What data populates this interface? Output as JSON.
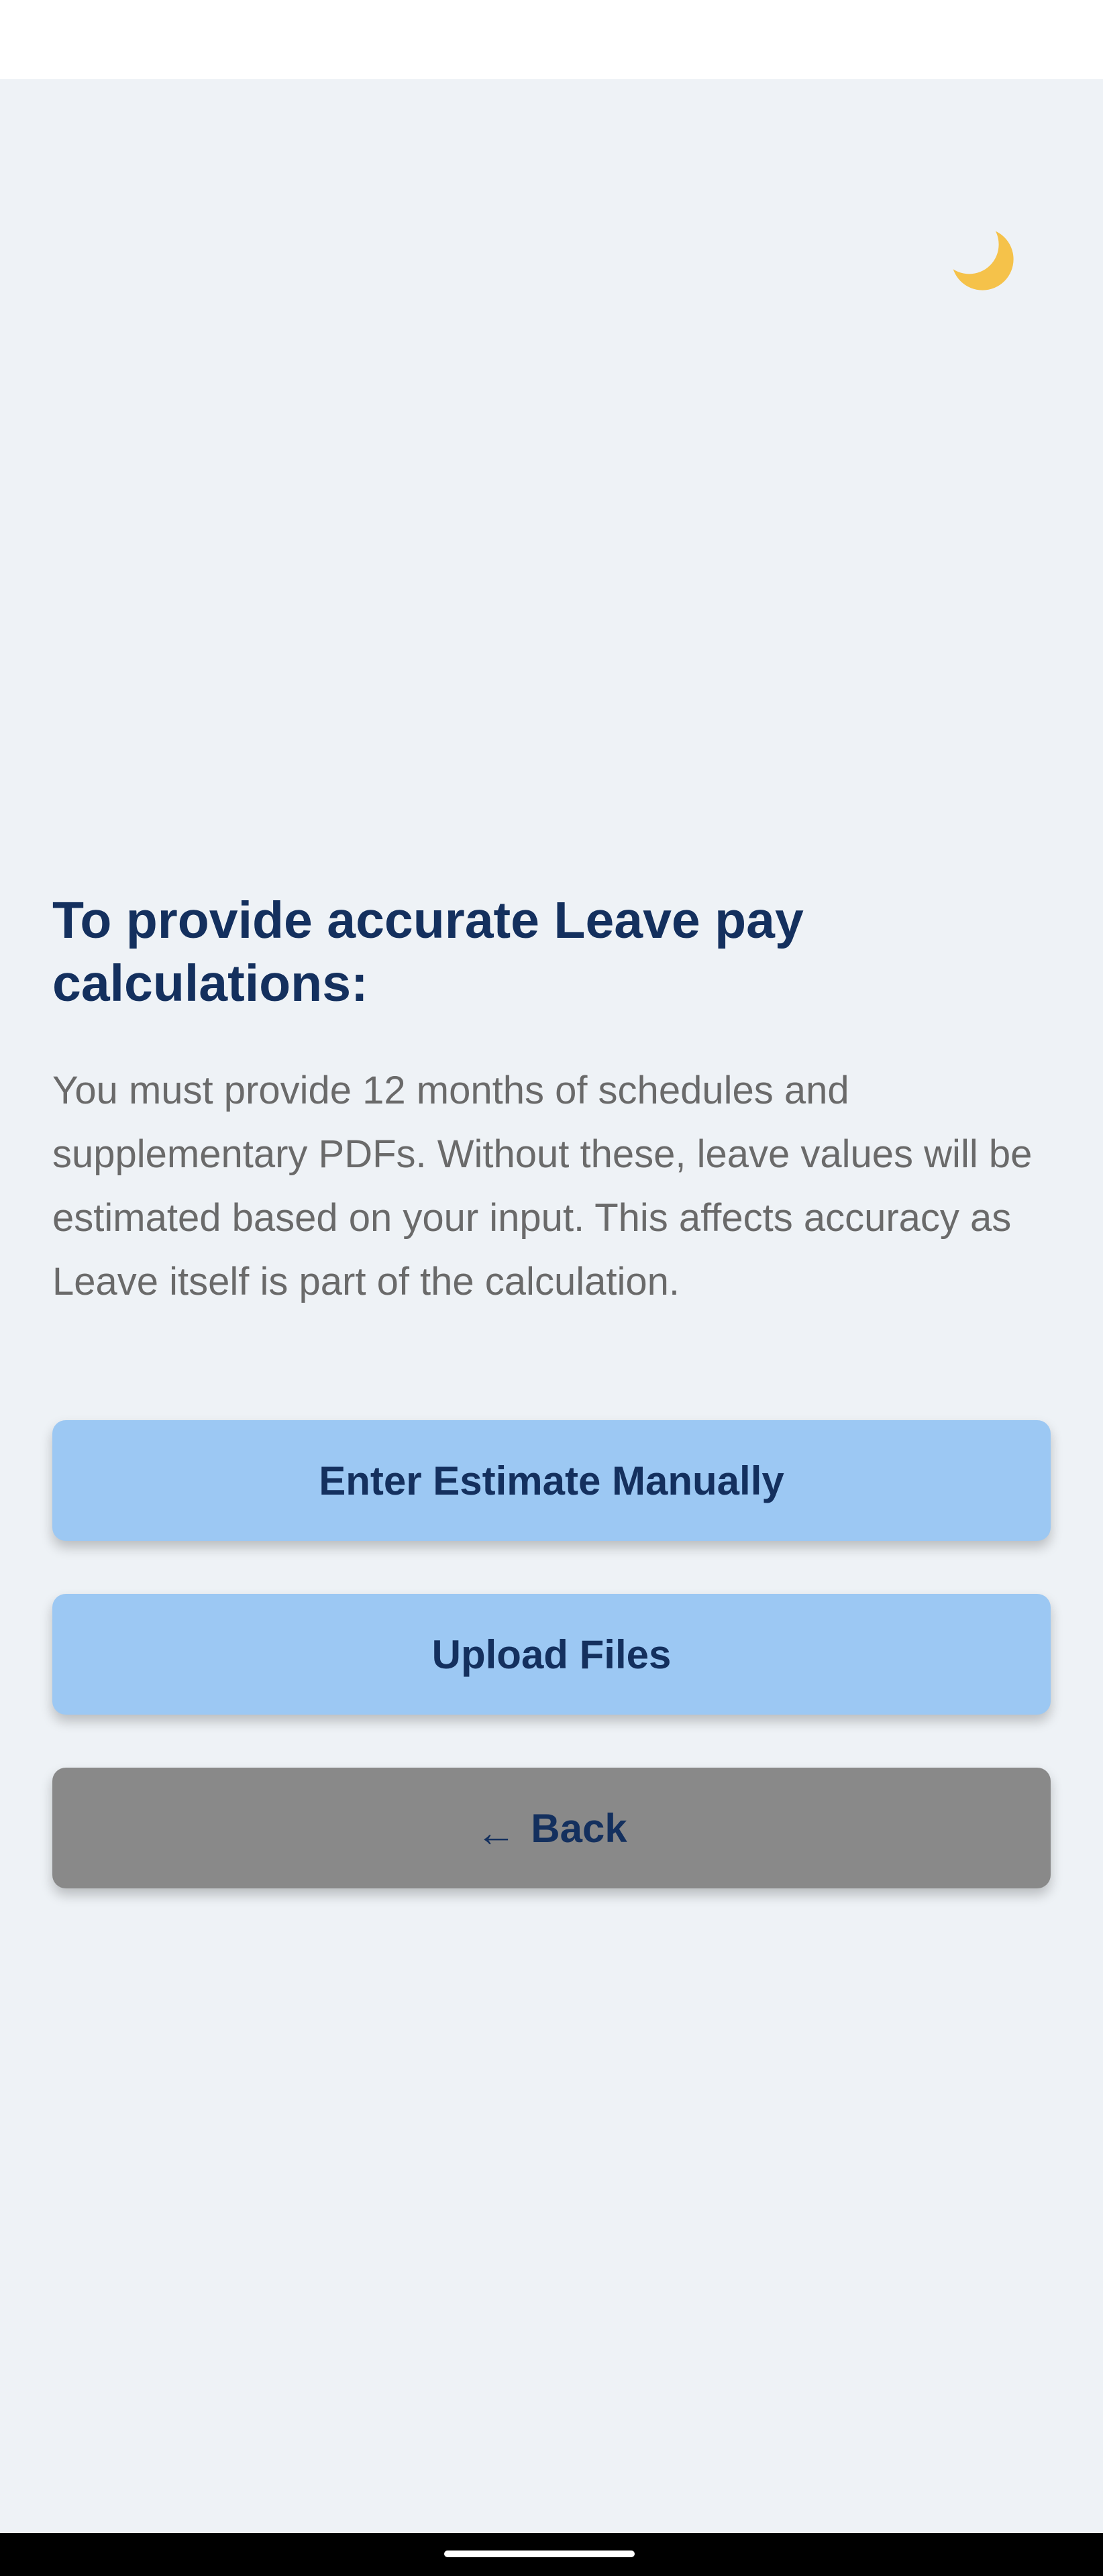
{
  "theme_toggle": {
    "icon": "crescent-moon-icon",
    "color": "#f5c24a"
  },
  "content": {
    "heading": "To provide accurate Leave pay calculations:",
    "notice": "You must provide 12 months of schedules and supplementary PDFs. Without these, leave values will be estimated based on your input. This affects accuracy as Leave itself is part of the calculation."
  },
  "actions": {
    "manual_label": "Enter Estimate Manually",
    "upload_label": "Upload Files",
    "back_arrow": "←",
    "back_label": "Back"
  },
  "colors": {
    "background": "#eef2f6",
    "heading": "#14305e",
    "primary_button": "#9cc8f3",
    "secondary_button": "#898989",
    "body_text": "#6a6a6a"
  }
}
